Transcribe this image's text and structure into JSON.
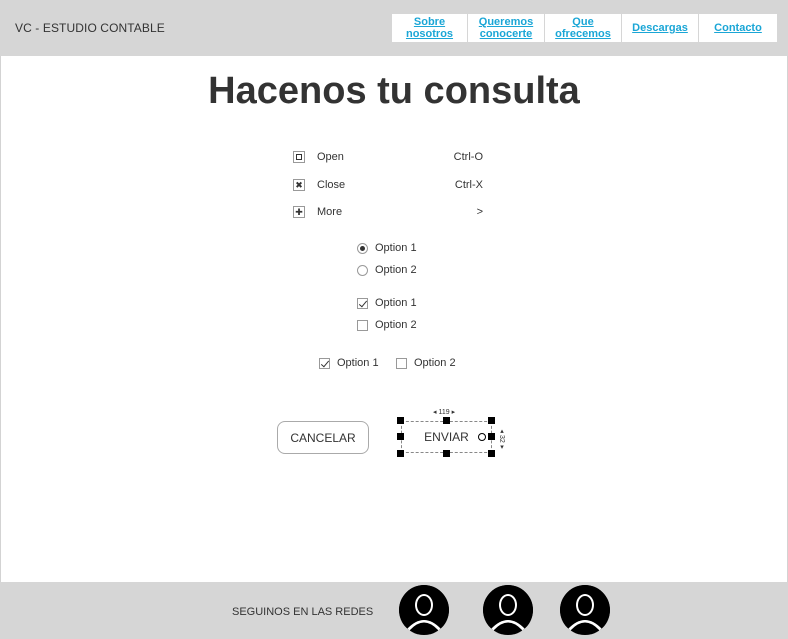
{
  "header": {
    "brand": "VC - ESTUDIO CONTABLE",
    "nav": [
      {
        "label": "Sobre nosotros"
      },
      {
        "label": "Queremos conocerte"
      },
      {
        "label": "Que ofrecemos"
      },
      {
        "label": "Descargas"
      },
      {
        "label": "Contacto"
      }
    ]
  },
  "main": {
    "title": "Hacenos tu consulta",
    "menu": [
      {
        "label": "Open",
        "shortcut": "Ctrl-O",
        "icon": "open-icon"
      },
      {
        "label": "Close",
        "shortcut": "Ctrl-X",
        "icon": "close-icon"
      },
      {
        "label": "More",
        "shortcut": ">",
        "icon": "plus-icon"
      }
    ],
    "radios": [
      {
        "label": "Option 1",
        "checked": true
      },
      {
        "label": "Option 2",
        "checked": false
      }
    ],
    "checkboxes_vertical": [
      {
        "label": "Option 1",
        "checked": true
      },
      {
        "label": "Option 2",
        "checked": false
      }
    ],
    "checkboxes_horizontal": [
      {
        "label": "Option 1",
        "checked": true
      },
      {
        "label": "Option 2",
        "checked": false
      }
    ],
    "buttons": {
      "cancel": "CANCELAR",
      "send": "ENVIAR"
    },
    "selection": {
      "width_label": "119",
      "height_label": "32"
    }
  },
  "footer": {
    "label": "SEGUINOS EN LAS REDES",
    "socials": [
      {
        "icon": "user-avatar-icon"
      },
      {
        "icon": "user-avatar-icon"
      },
      {
        "icon": "user-avatar-icon"
      }
    ]
  },
  "colors": {
    "header_bg": "#d6d6d6",
    "nav_link": "#1aa6d6",
    "text": "#333333"
  }
}
